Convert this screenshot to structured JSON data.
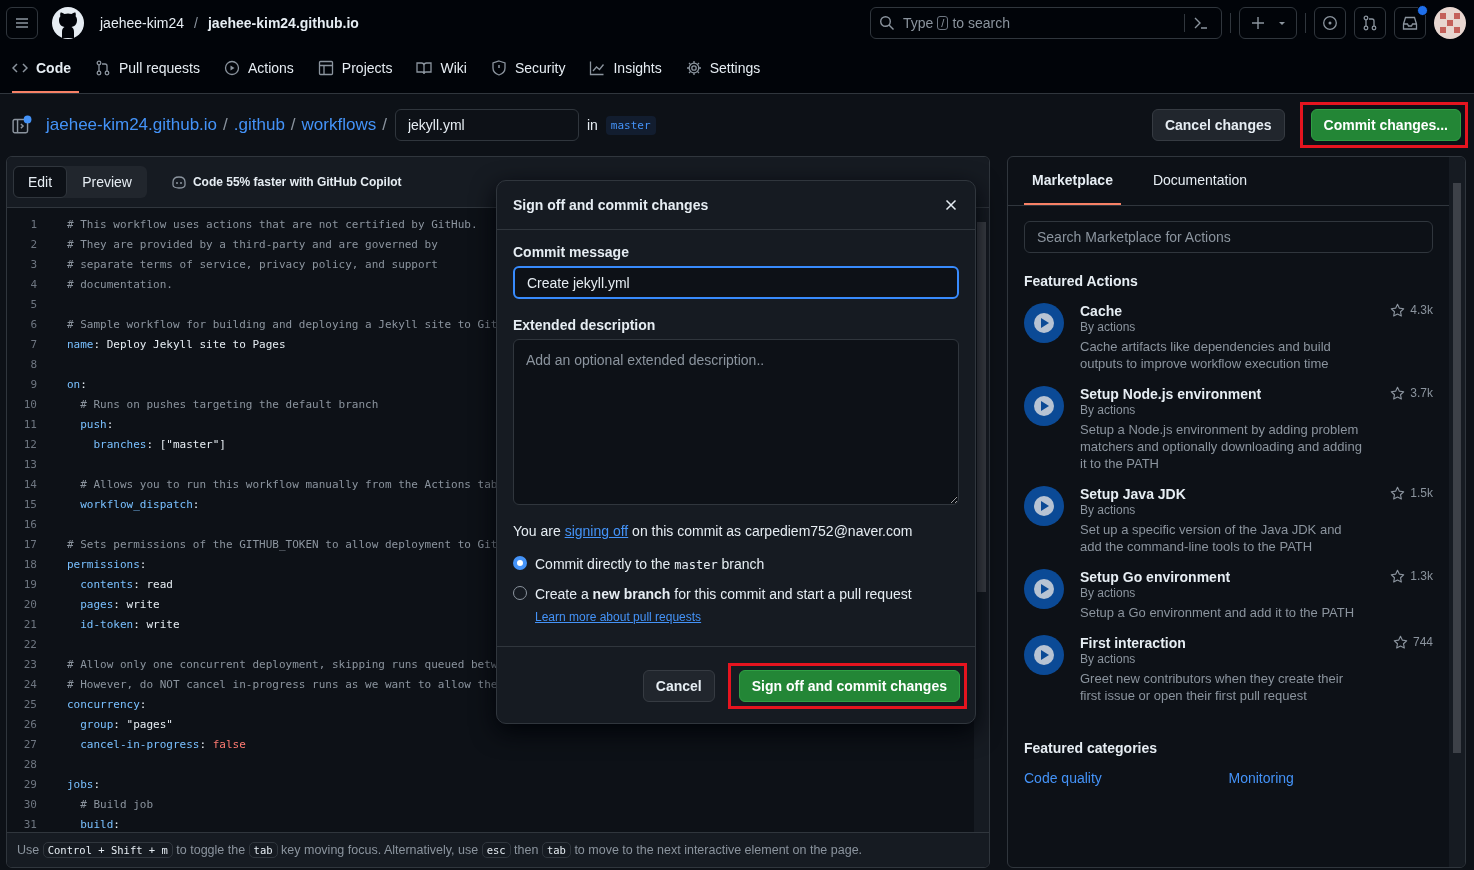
{
  "header": {
    "owner": "jaehee-kim24",
    "separator": "/",
    "repo": "jaehee-kim24.github.io",
    "search": {
      "before": "Type",
      "key": "/",
      "after": "to search"
    }
  },
  "repo_tabs": [
    {
      "label": "Code",
      "selected": true
    },
    {
      "label": "Pull requests",
      "selected": false
    },
    {
      "label": "Actions",
      "selected": false
    },
    {
      "label": "Projects",
      "selected": false
    },
    {
      "label": "Wiki",
      "selected": false
    },
    {
      "label": "Security",
      "selected": false
    },
    {
      "label": "Insights",
      "selected": false
    },
    {
      "label": "Settings",
      "selected": false
    }
  ],
  "toolbar": {
    "path": [
      {
        "kind": "link",
        "text": "jaehee-kim24.github.io"
      },
      {
        "kind": "sep",
        "text": "/"
      },
      {
        "kind": "link",
        "text": ".github"
      },
      {
        "kind": "sep",
        "text": "/"
      },
      {
        "kind": "link",
        "text": "workflows"
      },
      {
        "kind": "sep",
        "text": "/"
      }
    ],
    "filename": "jekyll.yml",
    "in_label": "in",
    "branch": "master",
    "buttons": [
      {
        "label": "Cancel changes",
        "kind": "secondary",
        "highlighted": false
      },
      {
        "label": "Commit changes...",
        "kind": "primary",
        "highlighted": true
      }
    ]
  },
  "editor": {
    "modes": [
      {
        "label": "Edit",
        "selected": true
      },
      {
        "label": "Preview",
        "selected": false
      }
    ],
    "copilot": "Code 55% faster with GitHub Copilot",
    "lines": [
      {
        "num": "1",
        "tokens": [
          {
            "kind": "comment",
            "text": "# This workflow uses actions that are not certified by GitHub."
          }
        ]
      },
      {
        "num": "2",
        "tokens": [
          {
            "kind": "comment",
            "text": "# They are provided by a third-party and are governed by"
          }
        ]
      },
      {
        "num": "3",
        "tokens": [
          {
            "kind": "comment",
            "text": "# separate terms of service, privacy policy, and support"
          }
        ]
      },
      {
        "num": "4",
        "tokens": [
          {
            "kind": "comment",
            "text": "# documentation."
          }
        ]
      },
      {
        "num": "5"
      },
      {
        "num": "6",
        "tokens": [
          {
            "kind": "comment",
            "text": "# Sample workflow for building and deploying a Jekyll site to Git"
          }
        ]
      },
      {
        "num": "7",
        "tokens": [
          {
            "kind": "key",
            "text": "name"
          },
          {
            "kind": "plain",
            "text": ": Deploy Jekyll site to Pages"
          }
        ]
      },
      {
        "num": "8"
      },
      {
        "num": "9",
        "tokens": [
          {
            "kind": "key",
            "text": "on"
          },
          {
            "kind": "plain",
            "text": ":"
          }
        ]
      },
      {
        "num": "10",
        "tokens": [
          {
            "kind": "comment",
            "text": "  # Runs on pushes targeting the default branch"
          }
        ]
      },
      {
        "num": "11",
        "tokens": [
          {
            "kind": "key",
            "text": "  push"
          },
          {
            "kind": "plain",
            "text": ":"
          }
        ]
      },
      {
        "num": "12",
        "tokens": [
          {
            "kind": "key",
            "text": "    branches"
          },
          {
            "kind": "plain",
            "text": ": [\"master\"]"
          }
        ]
      },
      {
        "num": "13"
      },
      {
        "num": "14",
        "tokens": [
          {
            "kind": "comment",
            "text": "  # Allows you to run this workflow manually from the Actions tab"
          }
        ]
      },
      {
        "num": "15",
        "tokens": [
          {
            "kind": "key",
            "text": "  workflow_dispatch"
          },
          {
            "kind": "plain",
            "text": ":"
          }
        ]
      },
      {
        "num": "16"
      },
      {
        "num": "17",
        "tokens": [
          {
            "kind": "comment",
            "text": "# Sets permissions of the GITHUB_TOKEN to allow deployment to Git"
          }
        ]
      },
      {
        "num": "18",
        "tokens": [
          {
            "kind": "key",
            "text": "permissions"
          },
          {
            "kind": "plain",
            "text": ":"
          }
        ]
      },
      {
        "num": "19",
        "tokens": [
          {
            "kind": "key",
            "text": "  contents"
          },
          {
            "kind": "plain",
            "text": ": read"
          }
        ]
      },
      {
        "num": "20",
        "tokens": [
          {
            "kind": "key",
            "text": "  pages"
          },
          {
            "kind": "plain",
            "text": ": write"
          }
        ]
      },
      {
        "num": "21",
        "tokens": [
          {
            "kind": "key",
            "text": "  id-token"
          },
          {
            "kind": "plain",
            "text": ": write"
          }
        ]
      },
      {
        "num": "22"
      },
      {
        "num": "23",
        "tokens": [
          {
            "kind": "comment",
            "text": "# Allow only one concurrent deployment, skipping runs queued betw"
          }
        ]
      },
      {
        "num": "24",
        "tokens": [
          {
            "kind": "comment",
            "text": "# However, do NOT cancel in-progress runs as we want to allow the"
          }
        ]
      },
      {
        "num": "25",
        "tokens": [
          {
            "kind": "key",
            "text": "concurrency"
          },
          {
            "kind": "plain",
            "text": ":"
          }
        ]
      },
      {
        "num": "26",
        "tokens": [
          {
            "kind": "key",
            "text": "  group"
          },
          {
            "kind": "plain",
            "text": ": \"pages\""
          }
        ]
      },
      {
        "num": "27",
        "tokens": [
          {
            "kind": "key",
            "text": "  cancel-in-progress"
          },
          {
            "kind": "plain",
            "text": ": "
          },
          {
            "kind": "bool",
            "text": "false"
          }
        ]
      },
      {
        "num": "28"
      },
      {
        "num": "29",
        "tokens": [
          {
            "kind": "key",
            "text": "jobs"
          },
          {
            "kind": "plain",
            "text": ":"
          }
        ]
      },
      {
        "num": "30",
        "tokens": [
          {
            "kind": "comment",
            "text": "  # Build job"
          }
        ]
      },
      {
        "num": "31",
        "tokens": [
          {
            "kind": "key",
            "text": "  build"
          },
          {
            "kind": "plain",
            "text": ":"
          }
        ]
      }
    ],
    "hint": [
      {
        "kind": "text",
        "text": "Use"
      },
      {
        "kind": "key",
        "text": "Control + Shift + m"
      },
      {
        "kind": "text",
        "text": "to toggle the"
      },
      {
        "kind": "key",
        "text": "tab"
      },
      {
        "kind": "text",
        "text": "key moving focus. Alternatively, use"
      },
      {
        "kind": "key",
        "text": "esc"
      },
      {
        "kind": "text",
        "text": "then"
      },
      {
        "kind": "key",
        "text": "tab"
      },
      {
        "kind": "text",
        "text": "to move to the next interactive element on the page."
      }
    ]
  },
  "dialog": {
    "title": "Sign off and commit changes",
    "message_label": "Commit message",
    "message": "Create jekyll.yml",
    "description_label": "Extended description",
    "description_placeholder": "Add an optional extended description..",
    "signoff": {
      "before": "You are",
      "link": "signing off",
      "after": "on this commit as carpediem752@naver.com"
    },
    "options": [
      {
        "selected": true,
        "parts": [
          {
            "kind": "text",
            "text": "Commit directly to the"
          },
          {
            "kind": "code",
            "text": "master"
          },
          {
            "kind": "text",
            "text": "branch"
          }
        ]
      },
      {
        "selected": false,
        "parts": [
          {
            "kind": "text",
            "text": "Create a **new branch** for this commit and start a pull request"
          },
          {
            "kind": "link",
            "text": "Learn more about pull requests"
          }
        ]
      }
    ],
    "buttons": [
      {
        "label": "Cancel",
        "kind": "secondary",
        "highlighted": false
      },
      {
        "label": "Sign off and commit changes",
        "kind": "primary",
        "highlighted": true
      }
    ]
  },
  "sidebar": {
    "tabs": [
      {
        "label": "Marketplace",
        "selected": true
      },
      {
        "label": "Documentation",
        "selected": false
      }
    ],
    "search_placeholder": "Search Marketplace for Actions",
    "featured_title": "Featured Actions",
    "actions": [
      {
        "name": "Cache",
        "author": "By actions",
        "description": "Cache artifacts like dependencies and build outputs to improve workflow execution time",
        "star_count": "4.3k"
      },
      {
        "name": "Setup Node.js environment",
        "author": "By actions",
        "description": "Setup a Node.js environment by adding problem matchers and optionally downloading and adding it to the PATH",
        "star_count": "3.7k"
      },
      {
        "name": "Setup Java JDK",
        "author": "By actions",
        "description": "Set up a specific version of the Java JDK and add the command-line tools to the PATH",
        "star_count": "1.5k"
      },
      {
        "name": "Setup Go environment",
        "author": "By actions",
        "description": "Setup a Go environment and add it to the PATH",
        "star_count": "1.3k"
      },
      {
        "name": "First interaction",
        "author": "By actions",
        "description": "Greet new contributors when they create their first issue or open their first pull request",
        "star_count": "744"
      }
    ],
    "categories_title": "Featured categories",
    "categories": [
      "Code quality",
      "Monitoring"
    ]
  }
}
